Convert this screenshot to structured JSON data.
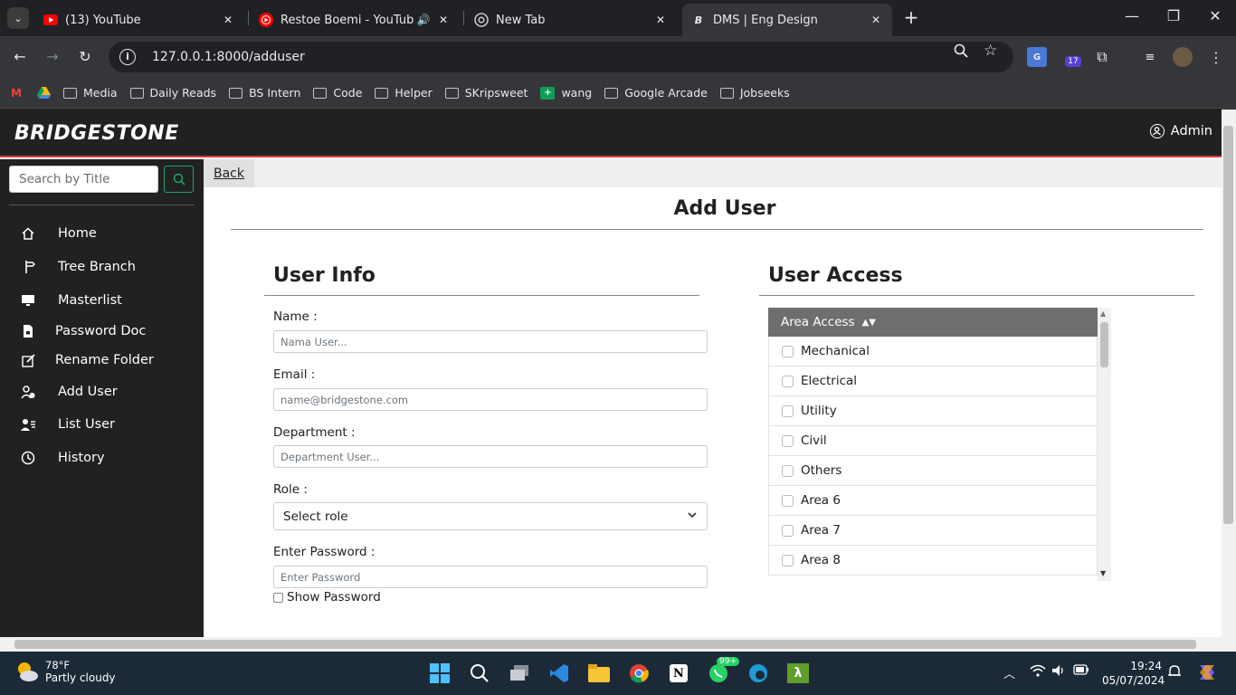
{
  "browser": {
    "tabs": [
      {
        "title": "(13) YouTube",
        "icon": "youtube-icon"
      },
      {
        "title": "Restoe Boemi - YouTube Mu",
        "icon": "youtube-music-icon",
        "audio": true
      },
      {
        "title": "New Tab",
        "icon": "chrome-icon"
      },
      {
        "title": "DMS | Eng Design",
        "icon": "bridgestone-b-icon",
        "active": true
      }
    ],
    "url": "127.0.0.1:8000/adduser",
    "ext_badge": "17",
    "bookmarks": [
      "Media",
      "Daily Reads",
      "BS Intern",
      "Code",
      "Helper",
      "SKripsweet",
      "wang",
      "Google Arcade",
      "Jobseeks"
    ]
  },
  "app": {
    "logo": "BRIDGESTONE",
    "user": "Admin",
    "brand_red": "#d63a3a",
    "search_placeholder": "Search by Title",
    "nav": [
      {
        "label": "Home",
        "icon": "home-icon"
      },
      {
        "label": "Tree Branch",
        "icon": "signpost-icon"
      },
      {
        "label": "Masterlist",
        "icon": "monitor-icon"
      },
      {
        "label": "Password Doc",
        "icon": "file-lock-icon"
      },
      {
        "label": "Rename Folder",
        "icon": "pencil-square-icon"
      },
      {
        "label": "Add User",
        "icon": "person-add-icon"
      },
      {
        "label": "List User",
        "icon": "person-list-icon"
      },
      {
        "label": "History",
        "icon": "clock-icon"
      }
    ]
  },
  "form": {
    "back": "Back",
    "page_title": "Add User",
    "user_info_title": "User Info",
    "user_access_title": "User Access",
    "name_label": "Name :",
    "name_placeholder": "Nama User...",
    "email_label": "Email :",
    "email_placeholder": "name@bridgestone.com",
    "department_label": "Department :",
    "department_placeholder": "Department User...",
    "role_label": "Role :",
    "role_selected": "Select role",
    "password_label": "Enter Password :",
    "password_placeholder": "Enter Password",
    "show_password": "Show Password",
    "area_access_header": "Area Access",
    "areas": [
      "Mechanical",
      "Electrical",
      "Utility",
      "Civil",
      "Others",
      "Area 6",
      "Area 7",
      "Area 8"
    ]
  },
  "taskbar": {
    "temp": "78°F",
    "weather": "Partly cloudy",
    "whatsapp_badge": "99+",
    "time": "19:24",
    "date": "05/07/2024"
  }
}
